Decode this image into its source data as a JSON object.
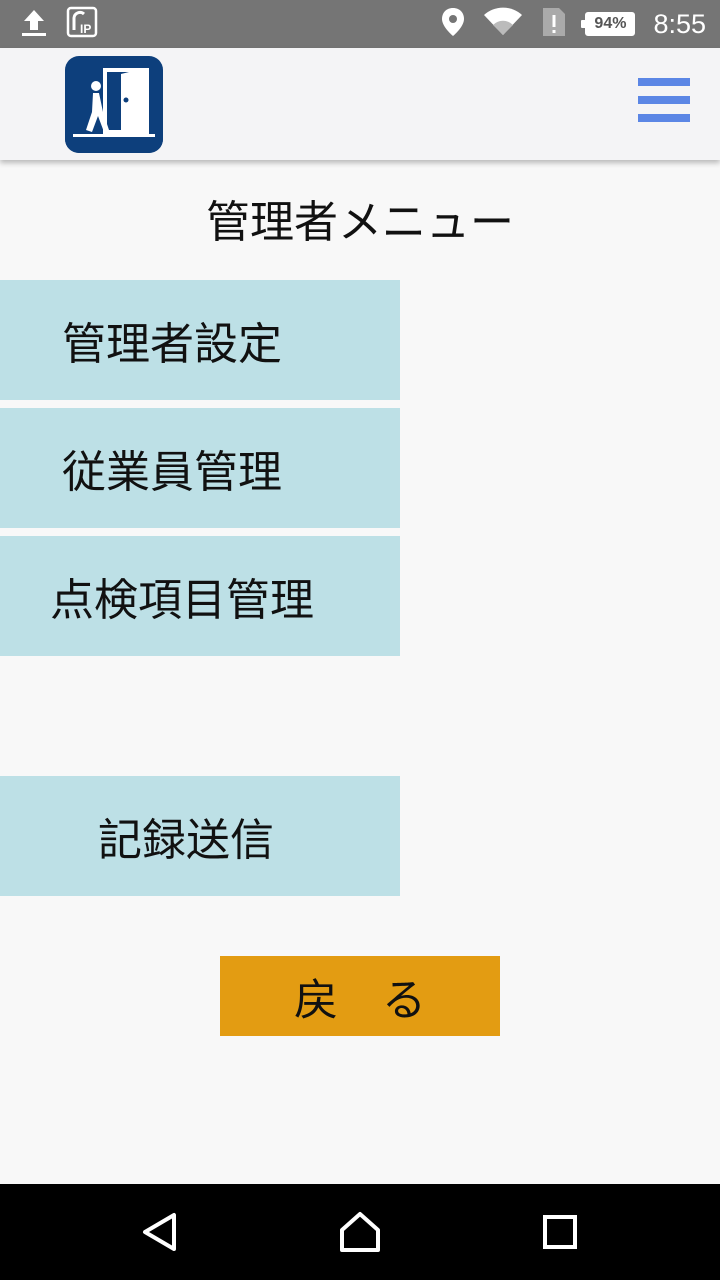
{
  "status_bar": {
    "battery": "94%",
    "time": "8:55",
    "icons": [
      "upload-icon",
      "ip-icon",
      "location-icon",
      "wifi-icon",
      "sim-alert-icon",
      "battery-icon"
    ]
  },
  "app_bar": {
    "logo_icon": "exit-door-person-icon",
    "menu_icon": "hamburger-menu-icon",
    "accent_color": "#5b86e5",
    "logo_color": "#0d3f7c"
  },
  "page": {
    "title": "管理者メニュー"
  },
  "menu": {
    "admin_settings": "管理者設定",
    "employee_management": "従業員管理",
    "inspection_item_management": "点検項目管理",
    "record_send": "記録送信",
    "tile_color": "#bde0e6"
  },
  "back_button": {
    "label": "戻　る",
    "color": "#e39c12"
  },
  "nav_bar": {
    "icons": [
      "back-triangle-icon",
      "home-icon",
      "recents-icon"
    ]
  }
}
